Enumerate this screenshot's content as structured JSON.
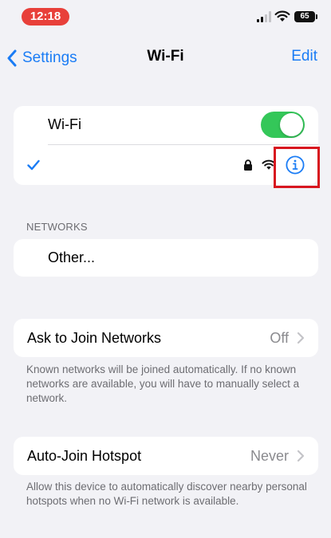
{
  "status_bar": {
    "time": "12:18",
    "battery": "65"
  },
  "nav": {
    "back_label": "Settings",
    "title": "Wi-Fi",
    "edit_label": "Edit"
  },
  "wifi_group": {
    "wifi_label": "Wi-Fi",
    "wifi_toggle_on": true,
    "connected_network": "",
    "accent_color": "#34c759"
  },
  "networks_section": {
    "header": "NETWORKS",
    "other_label": "Other..."
  },
  "ask_to_join": {
    "label": "Ask to Join Networks",
    "value": "Off",
    "footer": "Known networks will be joined automatically. If no known networks are available, you will have to manually select a network."
  },
  "auto_join": {
    "label": "Auto-Join Hotspot",
    "value": "Never",
    "footer": "Allow this device to automatically discover nearby personal hotspots when no Wi-Fi network is available."
  },
  "colors": {
    "link": "#1a7cf5",
    "highlight_box": "#d8161f",
    "time_pill": "#e8403a"
  }
}
